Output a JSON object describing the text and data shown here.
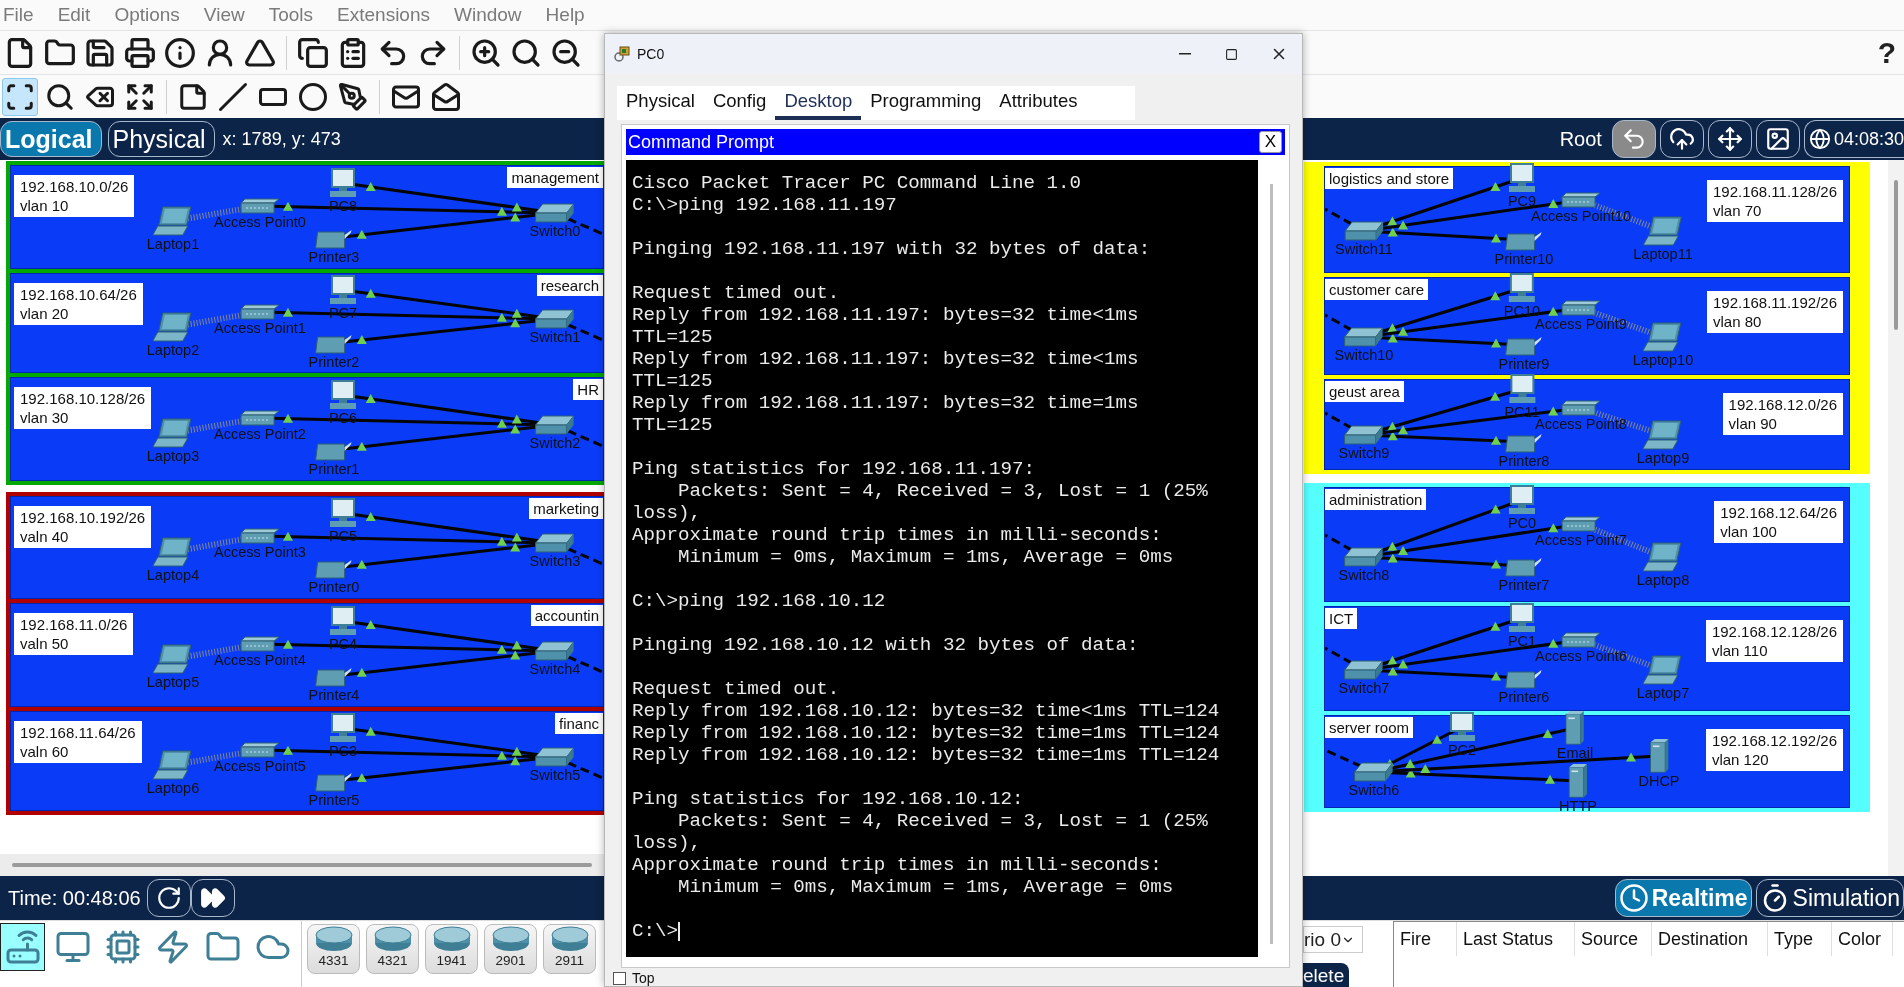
{
  "menu": [
    "File",
    "Edit",
    "Options",
    "View",
    "Tools",
    "Extensions",
    "Window",
    "Help"
  ],
  "help_glyph": "?",
  "edit_tools": [
    {
      "kind": "select",
      "selected": true
    },
    {
      "kind": "inspect",
      "selected": false
    },
    {
      "kind": "delete",
      "selected": false
    },
    {
      "kind": "resize",
      "selected": false
    },
    {
      "kind": "note",
      "selected": false
    },
    {
      "kind": "line",
      "selected": false
    },
    {
      "kind": "rectangle",
      "selected": false
    },
    {
      "kind": "ellipse",
      "selected": false
    },
    {
      "kind": "freeform",
      "selected": false
    },
    {
      "kind": "simple-pdu",
      "selected": false
    },
    {
      "kind": "complex-pdu",
      "selected": false
    }
  ],
  "view_tabs": [
    {
      "label": "Logical",
      "selected": true
    },
    {
      "label": "Physical",
      "selected": false
    }
  ],
  "cursor_position": "x: 1789, y: 473",
  "nav_right": {
    "root_label": "Root",
    "clock": "04:08:30"
  },
  "left_groups": [
    {
      "color": "#00a800",
      "areas": [
        {
          "name": "management",
          "subnet": "192.168.10.0/26",
          "vlan": "vlan 10",
          "devices": [
            {
              "name": "Laptop1",
              "kind": "laptop"
            },
            {
              "name": "Access Point0",
              "kind": "access-point"
            },
            {
              "name": "PC8",
              "kind": "pc"
            },
            {
              "name": "Printer3",
              "kind": "printer"
            },
            {
              "name": "Switch0",
              "kind": "switch"
            }
          ]
        },
        {
          "name": "research",
          "subnet": "192.168.10.64/26",
          "vlan": "vlan 20",
          "devices": [
            {
              "name": "Laptop2",
              "kind": "laptop"
            },
            {
              "name": "Access Point1",
              "kind": "access-point"
            },
            {
              "name": "PC7",
              "kind": "pc"
            },
            {
              "name": "Printer2",
              "kind": "printer"
            },
            {
              "name": "Switch1",
              "kind": "switch"
            }
          ]
        },
        {
          "name": "HR",
          "subnet": "192.168.10.128/26",
          "vlan": "vlan 30",
          "devices": [
            {
              "name": "Laptop3",
              "kind": "laptop"
            },
            {
              "name": "Access Point2",
              "kind": "access-point"
            },
            {
              "name": "PC6",
              "kind": "pc"
            },
            {
              "name": "Printer1",
              "kind": "printer"
            },
            {
              "name": "Switch2",
              "kind": "switch"
            }
          ]
        }
      ]
    },
    {
      "color": "#b00000",
      "areas": [
        {
          "name": "marketing",
          "subnet": "192.168.10.192/26",
          "vlan": "valn 40",
          "devices": [
            {
              "name": "Laptop4",
              "kind": "laptop"
            },
            {
              "name": "Access Point3",
              "kind": "access-point"
            },
            {
              "name": "PC5",
              "kind": "pc"
            },
            {
              "name": "Printer0",
              "kind": "printer"
            },
            {
              "name": "Switch3",
              "kind": "switch"
            }
          ]
        },
        {
          "name": "accountin",
          "subnet": "192.168.11.0/26",
          "vlan": "valn 50",
          "devices": [
            {
              "name": "Laptop5",
              "kind": "laptop"
            },
            {
              "name": "Access Point4",
              "kind": "access-point"
            },
            {
              "name": "PC4",
              "kind": "pc"
            },
            {
              "name": "Printer4",
              "kind": "printer"
            },
            {
              "name": "Switch4",
              "kind": "switch"
            }
          ]
        },
        {
          "name": "financ",
          "subnet": "192.168.11.64/26",
          "vlan": "valn 60",
          "devices": [
            {
              "name": "Laptop6",
              "kind": "laptop"
            },
            {
              "name": "Access Point5",
              "kind": "access-point"
            },
            {
              "name": "PC3",
              "kind": "pc"
            },
            {
              "name": "Printer5",
              "kind": "printer"
            },
            {
              "name": "Switch5",
              "kind": "switch"
            }
          ]
        }
      ]
    }
  ],
  "right_groups": [
    {
      "color": "#ffff00",
      "areas": [
        {
          "name": "logistics and store",
          "subnet": "192.168.11.128/26",
          "vlan": "vlan 70",
          "devices": [
            {
              "name": "Switch11",
              "kind": "switch"
            },
            {
              "name": "PC9",
              "kind": "pc"
            },
            {
              "name": "Printer10",
              "kind": "printer"
            },
            {
              "name": "Access Point10",
              "kind": "access-point"
            },
            {
              "name": "Laptop11",
              "kind": "laptop"
            }
          ]
        },
        {
          "name": "customer care",
          "subnet": "192.168.11.192/26",
          "vlan": "vlan 80",
          "devices": [
            {
              "name": "Switch10",
              "kind": "switch"
            },
            {
              "name": "PC10",
              "kind": "pc"
            },
            {
              "name": "Printer9",
              "kind": "printer"
            },
            {
              "name": "Access Point9",
              "kind": "access-point"
            },
            {
              "name": "Laptop10",
              "kind": "laptop"
            }
          ]
        },
        {
          "name": "geust area",
          "subnet": "192.168.12.0/26",
          "vlan": "vlan 90",
          "devices": [
            {
              "name": "Switch9",
              "kind": "switch"
            },
            {
              "name": "PC11",
              "kind": "pc"
            },
            {
              "name": "Printer8",
              "kind": "printer"
            },
            {
              "name": "Access Point8",
              "kind": "access-point"
            },
            {
              "name": "Laptop9",
              "kind": "laptop"
            }
          ]
        }
      ]
    },
    {
      "color": "#55ffff",
      "areas": [
        {
          "name": "administration",
          "subnet": "192.168.12.64/26",
          "vlan": "vlan 100",
          "devices": [
            {
              "name": "Switch8",
              "kind": "switch"
            },
            {
              "name": "PC0",
              "kind": "pc"
            },
            {
              "name": "Printer7",
              "kind": "printer"
            },
            {
              "name": "Access Point7",
              "kind": "access-point"
            },
            {
              "name": "Laptop8",
              "kind": "laptop"
            }
          ]
        },
        {
          "name": "ICT",
          "subnet": "192.168.12.128/26",
          "vlan": "vlan 110",
          "devices": [
            {
              "name": "Switch7",
              "kind": "switch"
            },
            {
              "name": "PC1",
              "kind": "pc"
            },
            {
              "name": "Printer6",
              "kind": "printer"
            },
            {
              "name": "Access Point6",
              "kind": "access-point"
            },
            {
              "name": "Laptop7",
              "kind": "laptop"
            }
          ]
        },
        {
          "name": "server room",
          "subnet": "192.168.12.192/26",
          "vlan": "vlan 120",
          "devices": [
            {
              "name": "Switch6",
              "kind": "switch"
            },
            {
              "name": "PC2",
              "kind": "pc"
            },
            {
              "name": "Email",
              "kind": "server"
            },
            {
              "name": "HTTP",
              "kind": "server"
            },
            {
              "name": "DHCP",
              "kind": "server"
            }
          ]
        }
      ]
    }
  ],
  "dialog": {
    "title": "PC0",
    "tabs": [
      {
        "label": "Physical",
        "selected": false
      },
      {
        "label": "Config",
        "selected": false
      },
      {
        "label": "Desktop",
        "selected": true
      },
      {
        "label": "Programming",
        "selected": false
      },
      {
        "label": "Attributes",
        "selected": false
      }
    ],
    "prompt_title": "Command Prompt",
    "prompt_close": "X",
    "console_blocks": [
      [
        "Cisco Packet Tracer PC Command Line 1.0",
        "C:\\>ping 192.168.11.197"
      ],
      [
        "Pinging 192.168.11.197 with 32 bytes of data:"
      ],
      [
        "Request timed out.",
        "Reply from 192.168.11.197: bytes=32 time<1ms",
        "TTL=125",
        "Reply from 192.168.11.197: bytes=32 time<1ms",
        "TTL=125",
        "Reply from 192.168.11.197: bytes=32 time=1ms",
        "TTL=125"
      ],
      [
        "Ping statistics for 192.168.11.197:",
        "    Packets: Sent = 4, Received = 3, Lost = 1 (25%",
        "loss),",
        "Approximate round trip times in milli-seconds:",
        "    Minimum = 0ms, Maximum = 1ms, Average = 0ms"
      ],
      [
        "C:\\>ping 192.168.10.12"
      ],
      [
        "Pinging 192.168.10.12 with 32 bytes of data:"
      ],
      [
        "Request timed out.",
        "Reply from 192.168.10.12: bytes=32 time<1ms TTL=124",
        "Reply from 192.168.10.12: bytes=32 time=1ms TTL=124",
        "Reply from 192.168.10.12: bytes=32 time=1ms TTL=124"
      ],
      [
        "Ping statistics for 192.168.10.12:",
        "    Packets: Sent = 4, Received = 3, Lost = 1 (25%",
        "loss),",
        "Approximate round trip times in milli-seconds:",
        "    Minimum = 0ms, Maximum = 1ms, Average = 0ms"
      ],
      [
        "C:\\>"
      ]
    ],
    "top_option": {
      "label": "Top",
      "checked": false
    }
  },
  "time_bar": {
    "time": "Time: 00:48:06",
    "modes": [
      {
        "label": "Realtime",
        "kind": "realtime",
        "selected": true
      },
      {
        "label": "Simulation",
        "kind": "simulation",
        "selected": false
      }
    ]
  },
  "palette": {
    "categories": [
      {
        "kind": "network",
        "selected": true
      },
      {
        "kind": "end-devices",
        "selected": false
      },
      {
        "kind": "components",
        "selected": false
      },
      {
        "kind": "connections",
        "selected": false
      },
      {
        "kind": "misc",
        "selected": false
      },
      {
        "kind": "multiuser",
        "selected": false
      }
    ],
    "models": [
      "4331",
      "4321",
      "1941",
      "2901",
      "2911"
    ]
  },
  "pdu": {
    "scenario": "rio 0",
    "delete": "elete",
    "columns": [
      "Fire",
      "Last Status",
      "Source",
      "Destination",
      "Type",
      "Color"
    ]
  }
}
